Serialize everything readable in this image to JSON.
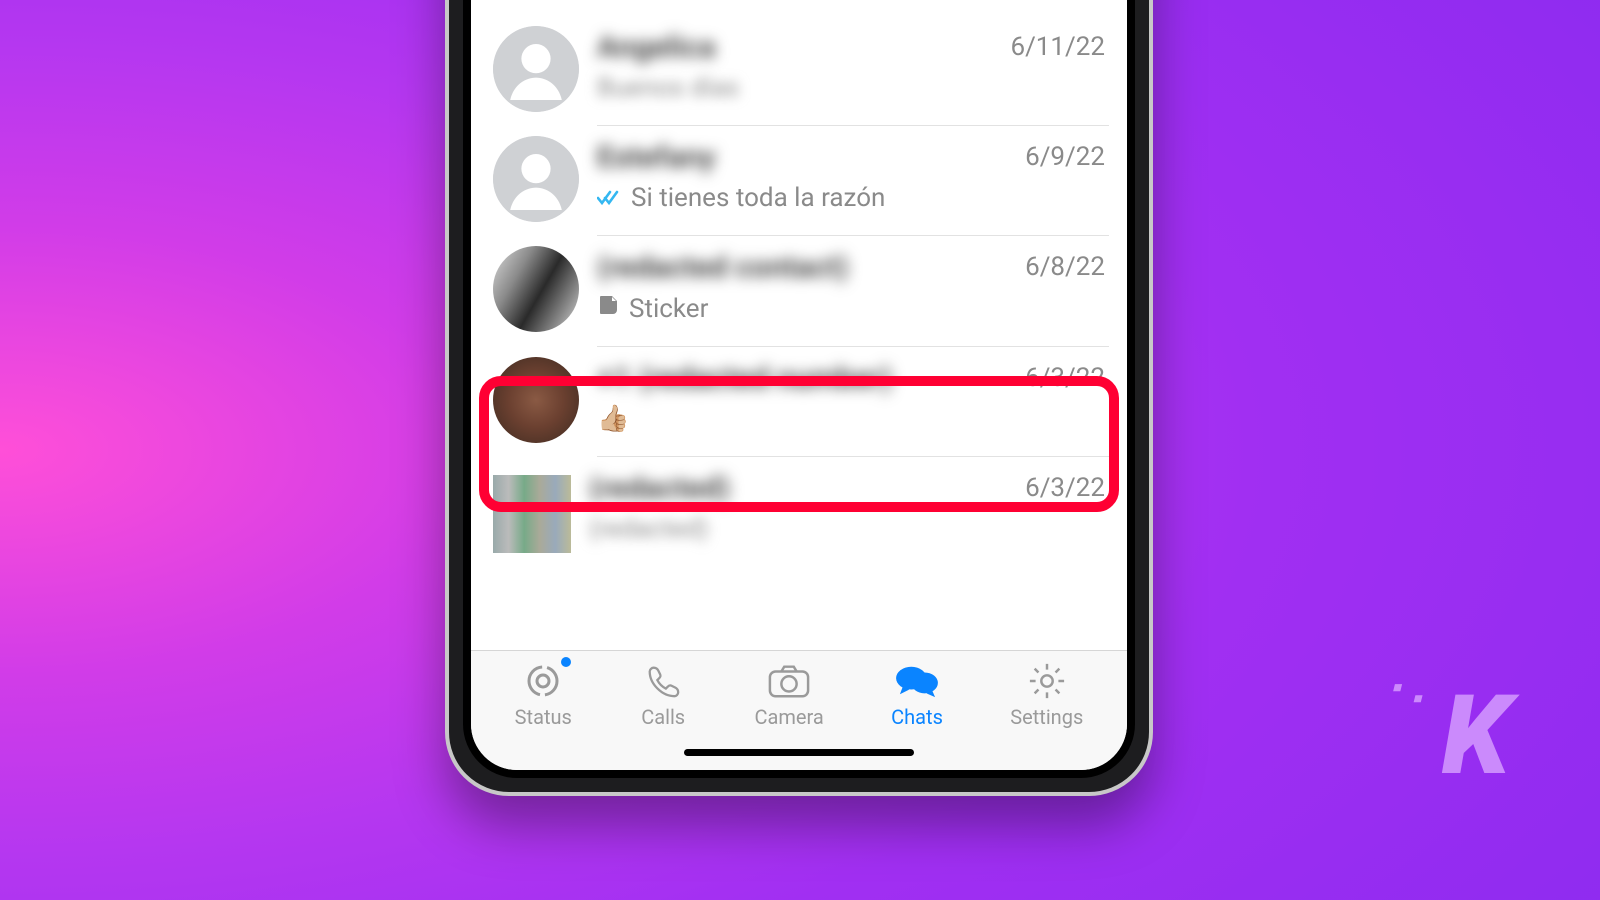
{
  "chats": [
    {
      "name": "Angelica",
      "snippet": "Buenos días",
      "date": "6/11/22",
      "avatar": "placeholder"
    },
    {
      "name": "Estefany",
      "snippet": "Si tienes toda la razón",
      "date": "6/9/22",
      "avatar": "placeholder",
      "read": true
    },
    {
      "name": "(redacted contact)",
      "snippet": "Sticker",
      "date": "6/8/22",
      "avatar": "photo",
      "sticker": true
    },
    {
      "name": "+1 (redacted number)",
      "snippet": "👍🏼",
      "date": "6/3/22",
      "avatar": "photo",
      "highlighted": true
    },
    {
      "name": "(redacted)",
      "snippet": "(redacted)",
      "date": "6/3/22",
      "avatar": "photo-square"
    }
  ],
  "sticker_label": "Sticker",
  "tabs": {
    "status": "Status",
    "calls": "Calls",
    "camera": "Camera",
    "chats": "Chats",
    "settings": "Settings"
  },
  "watermark": "K"
}
